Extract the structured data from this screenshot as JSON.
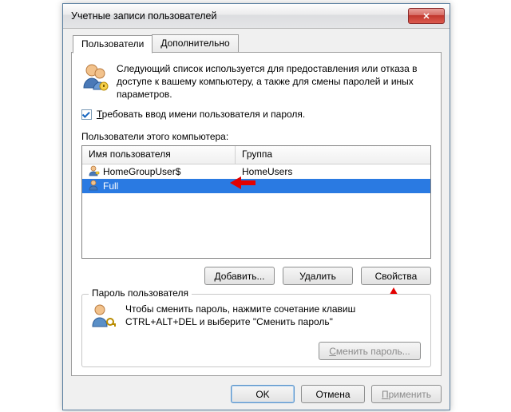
{
  "window": {
    "title": "Учетные записи пользователей"
  },
  "tabs": {
    "users": "Пользователи",
    "advanced": "Дополнительно"
  },
  "intro": "Следующий список используется для предоставления или отказа в доступе к вашему компьютеру, а также для смены паролей и иных параметров.",
  "require_login": {
    "label": "Требовать ввод имени пользователя и пароля.",
    "checked": true
  },
  "list": {
    "label": "Пользователи этого компьютера:",
    "cols": {
      "user": "Имя пользователя",
      "group": "Группа"
    },
    "rows": [
      {
        "user": "HomeGroupUser$",
        "group": "HomeUsers",
        "selected": false
      },
      {
        "user": "Full",
        "group": "",
        "selected": true
      }
    ]
  },
  "buttons": {
    "add": "Добавить...",
    "remove": "Удалить",
    "properties": "Свойства",
    "ok": "OK",
    "cancel": "Отмена",
    "apply": "Применить"
  },
  "password_group": {
    "legend": "Пароль пользователя",
    "text": "Чтобы сменить пароль, нажмите сочетание клавиш CTRL+ALT+DEL и выберите \"Сменить пароль\"",
    "button": "Сменить пароль..."
  }
}
